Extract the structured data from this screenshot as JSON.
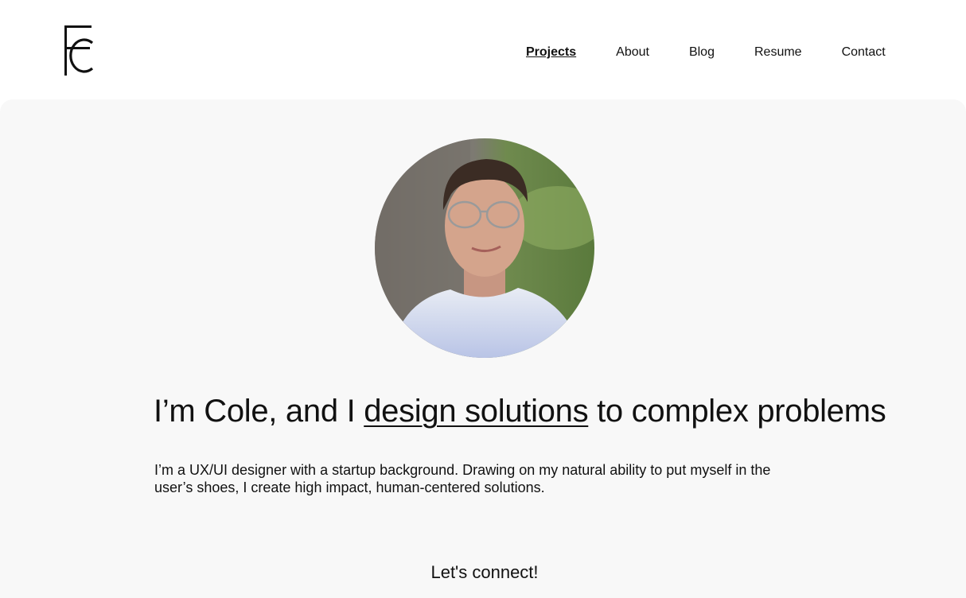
{
  "header": {
    "logo_icon": "fc-monogram-logo",
    "nav": [
      {
        "label": "Projects",
        "active": true
      },
      {
        "label": "About",
        "active": false
      },
      {
        "label": "Blog",
        "active": false
      },
      {
        "label": "Resume",
        "active": false
      },
      {
        "label": "Contact",
        "active": false
      }
    ]
  },
  "hero": {
    "avatar_icon": "profile-photo",
    "headline": {
      "prefix": "I’m Cole, and I ",
      "link": "design solutions",
      "suffix": " to complex problems"
    },
    "intro": "I’m a UX/UI designer with a startup background. Drawing on my natural ability to put myself in the user’s shoes, I create high impact, human-centered solutions.",
    "connect": "Let's connect!"
  },
  "colors": {
    "page_bg": "#ffffff",
    "hero_bg": "#f8f8f8",
    "text": "#111111"
  }
}
